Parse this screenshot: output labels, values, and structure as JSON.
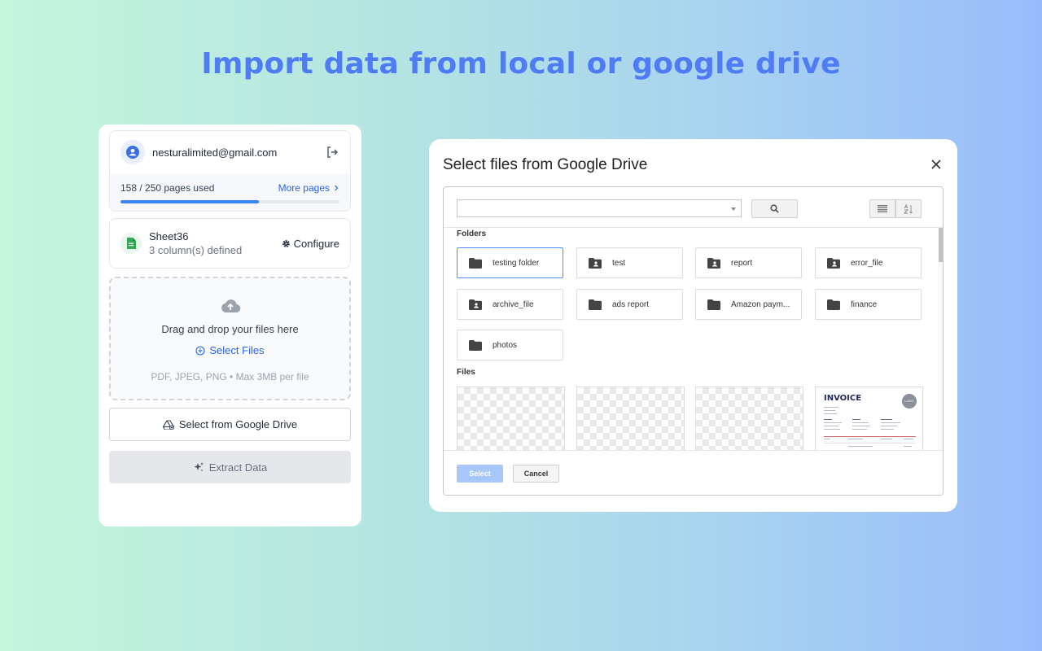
{
  "headline": "Import data from local or google drive",
  "colors": {
    "accent": "#4f7cf5",
    "link": "#2563eb",
    "progress": "#3b82f6",
    "sheets_green": "#34a853"
  },
  "account": {
    "email": "nesturalimited@gmail.com",
    "usage_text": "158 / 250 pages used",
    "more_pages_label": "More pages",
    "pages_used": 158,
    "pages_total": 250
  },
  "sheet": {
    "name": "Sheet36",
    "subtitle": "3 column(s) defined",
    "configure_label": "Configure"
  },
  "dropzone": {
    "title": "Drag and drop your files here",
    "select_label": "Select Files",
    "hint": "PDF, JPEG, PNG • Max 3MB per file"
  },
  "buttons": {
    "google_drive": "Select from Google Drive",
    "extract": "Extract Data"
  },
  "drive": {
    "title": "Select files from Google Drive",
    "folders_label": "Folders",
    "files_label": "Files",
    "folders": [
      {
        "name": "testing folder",
        "icon": "folder-icon",
        "selected": true
      },
      {
        "name": "test",
        "icon": "shared-folder-icon"
      },
      {
        "name": "report",
        "icon": "shared-folder-icon"
      },
      {
        "name": "error_file",
        "icon": "shared-folder-icon"
      },
      {
        "name": "archive_file",
        "icon": "shared-folder-icon"
      },
      {
        "name": "ads report",
        "icon": "folder-icon"
      },
      {
        "name": "Amazon paym...",
        "icon": "folder-icon"
      },
      {
        "name": "finance",
        "icon": "folder-icon"
      },
      {
        "name": "photos",
        "icon": "folder-icon"
      }
    ],
    "invoice_title": "INVOICE",
    "invoice_logo": "LOGO",
    "select_button": "Select",
    "cancel_button": "Cancel"
  }
}
